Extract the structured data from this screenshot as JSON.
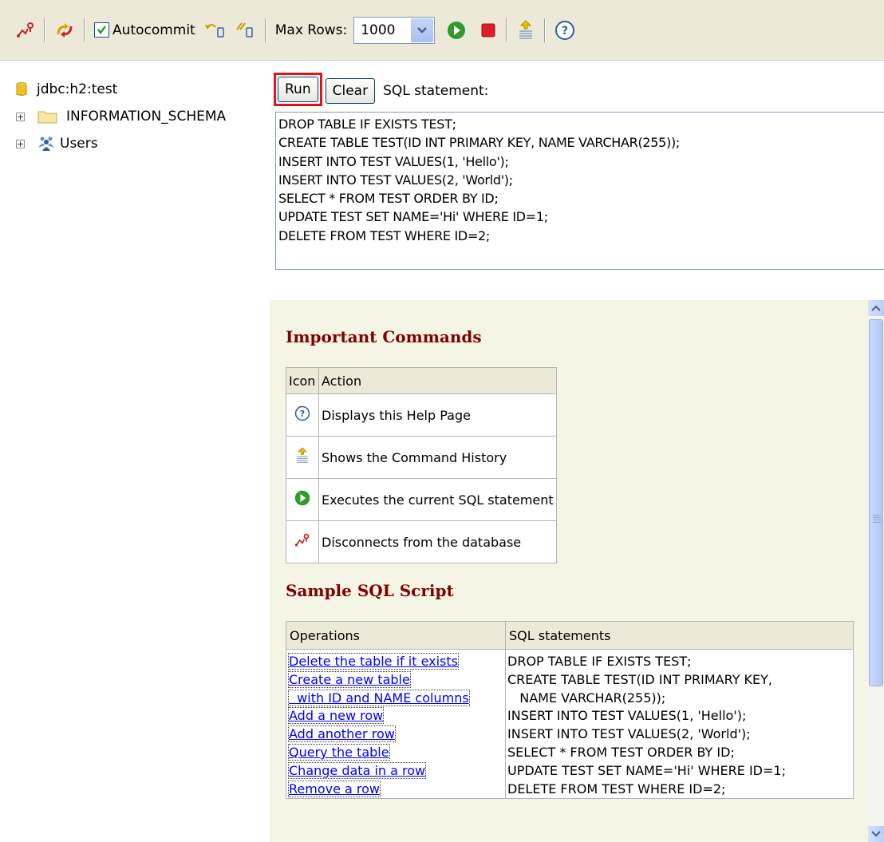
{
  "toolbar": {
    "autocommit_label": "Autocommit",
    "autocommit_checked": true,
    "max_rows_label": "Max Rows:",
    "max_rows_value": "1000"
  },
  "tree": {
    "connection": "jdbc:h2:test",
    "items": [
      {
        "label": "INFORMATION_SCHEMA",
        "icon": "folder-icon"
      },
      {
        "label": "Users",
        "icon": "users-icon"
      }
    ]
  },
  "query": {
    "run_label": "Run",
    "clear_label": "Clear",
    "sql_label": "SQL statement:",
    "sql_text": "DROP TABLE IF EXISTS TEST;\nCREATE TABLE TEST(ID INT PRIMARY KEY, NAME VARCHAR(255));\nINSERT INTO TEST VALUES(1, 'Hello');\nINSERT INTO TEST VALUES(2, 'World');\nSELECT * FROM TEST ORDER BY ID;\nUPDATE TEST SET NAME='Hi' WHERE ID=1;\nDELETE FROM TEST WHERE ID=2;"
  },
  "help": {
    "important_title": "Important Commands",
    "cmd_headers": [
      "Icon",
      "Action"
    ],
    "commands": [
      {
        "icon": "help-icon",
        "action": "Displays this Help Page"
      },
      {
        "icon": "history-icon",
        "action": "Shows the Command History"
      },
      {
        "icon": "execute-icon",
        "action": "Executes the current SQL statement"
      },
      {
        "icon": "disconnect-icon",
        "action": "Disconnects from the database"
      }
    ],
    "sample_title": "Sample SQL Script",
    "sample_headers": [
      "Operations",
      "SQL statements"
    ],
    "operations": [
      "Delete the table if it exists",
      "Create a new table",
      "  with ID and NAME columns",
      "Add a new row",
      "Add another row",
      "Query the table",
      "Change data in a row",
      "Remove a row"
    ],
    "statements": [
      "DROP TABLE IF EXISTS TEST;",
      "CREATE TABLE TEST(ID INT PRIMARY KEY,",
      "   NAME VARCHAR(255));",
      "INSERT INTO TEST VALUES(1, 'Hello');",
      "INSERT INTO TEST VALUES(2, 'World');",
      "SELECT * FROM TEST ORDER BY ID;",
      "UPDATE TEST SET NAME='Hi' WHERE ID=1;",
      "DELETE FROM TEST WHERE ID=2;"
    ]
  },
  "colors": {
    "heading": "#800000",
    "link": "#0000ff",
    "run_highlight": "#e2141c",
    "toolbar_bg": "#ece9d8",
    "help_bg": "#f5f5e6"
  }
}
